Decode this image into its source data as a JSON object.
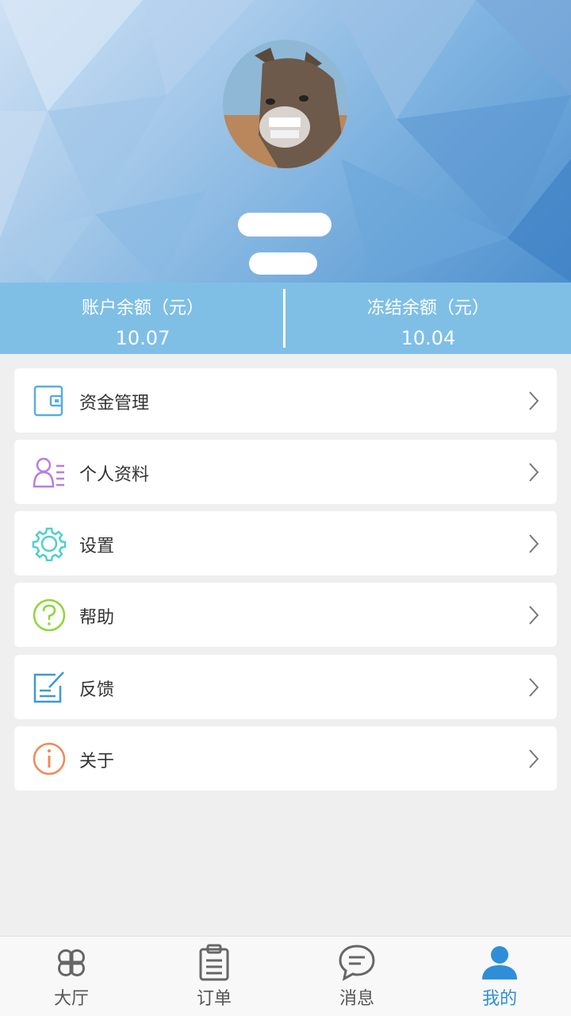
{
  "header": {
    "avatar": "donkey-avatar"
  },
  "balance": {
    "account_label": "账户余额（元）",
    "account_value": "10.07",
    "frozen_label": "冻结余额（元）",
    "frozen_value": "10.04"
  },
  "menu": [
    {
      "label": "资金管理",
      "icon": "wallet-icon",
      "color": "#5aace0"
    },
    {
      "label": "个人资料",
      "icon": "profile-card-icon",
      "color": "#b97ce6"
    },
    {
      "label": "设置",
      "icon": "gear-icon",
      "color": "#4fcfd0"
    },
    {
      "label": "帮助",
      "icon": "help-icon",
      "color": "#8fd63a"
    },
    {
      "label": "反馈",
      "icon": "feedback-icon",
      "color": "#3e97db"
    },
    {
      "label": "关于",
      "icon": "info-icon",
      "color": "#f08a55"
    }
  ],
  "tabs": [
    {
      "label": "大厅",
      "icon": "clover-icon"
    },
    {
      "label": "订单",
      "icon": "clipboard-icon"
    },
    {
      "label": "消息",
      "icon": "chat-icon"
    },
    {
      "label": "我的",
      "icon": "user-icon",
      "active": true
    }
  ],
  "colors": {
    "accent": "#2e8fd8",
    "balance_bar": "#7fbfe6"
  }
}
